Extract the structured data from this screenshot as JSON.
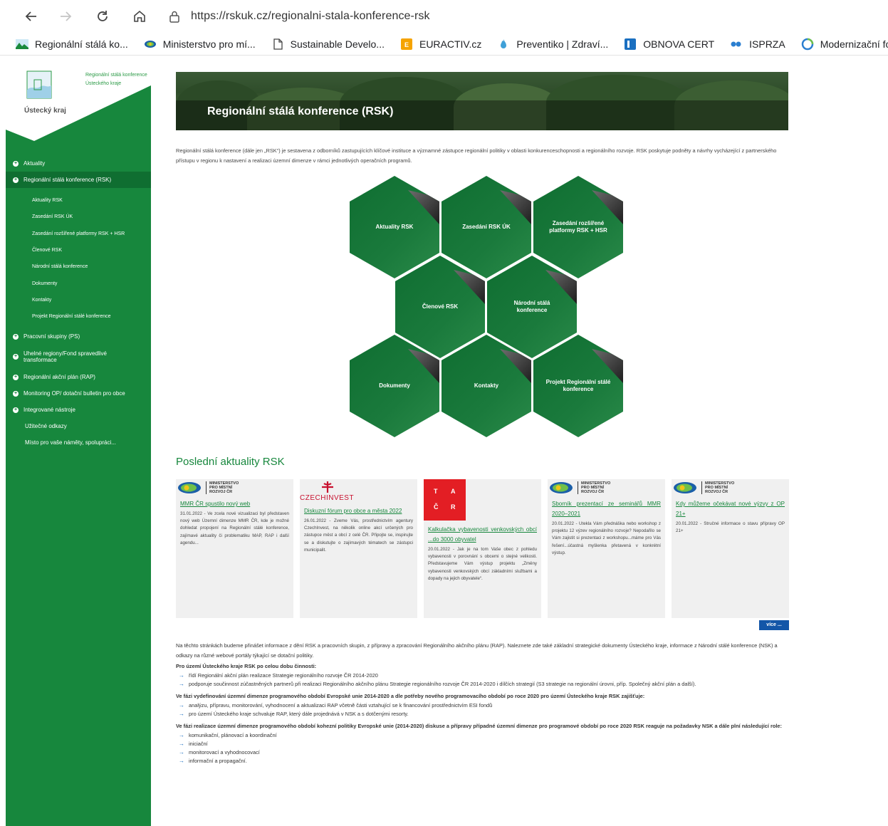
{
  "browser": {
    "url": "https://rskuk.cz/regionalni-stala-konference-rsk",
    "bookmarks": [
      {
        "label": "Regionální stálá ko...",
        "icon": "mountain-icon"
      },
      {
        "label": "Ministerstvo pro mí...",
        "icon": "mmr-icon"
      },
      {
        "label": "Sustainable Develo...",
        "icon": "page-icon"
      },
      {
        "label": "EURACTIV.cz",
        "icon": "euractiv-icon"
      },
      {
        "label": "Preventiko | Zdraví...",
        "icon": "flame-icon"
      },
      {
        "label": "OBNOVA CERT",
        "icon": "cert-icon"
      },
      {
        "label": "ISPRZA",
        "icon": "dots-icon"
      },
      {
        "label": "Modernizační fond...",
        "icon": "circle-icon"
      }
    ]
  },
  "sidebar": {
    "logo_caption_line1": "Regionální stálá konference",
    "logo_caption_line2": "Ústeckého kraje",
    "logo_name": "Ústecký kraj",
    "menu": [
      {
        "label": "Aktuality",
        "bullet": true
      },
      {
        "label": "Regionální stálá konference (RSK)",
        "bullet": true,
        "active": true
      }
    ],
    "submenu": [
      "Aktuality RSK",
      "Zasedání RSK ÚK",
      "Zasedání rozšířené platformy RSK + HSR",
      "Členové RSK",
      "Národní stálá konference",
      "Dokumenty",
      "Kontakty",
      "Projekt Regionální stálé konference"
    ],
    "menu2": [
      {
        "label": "Pracovní skupiny (PS)",
        "bullet": true
      },
      {
        "label": "Uhelné regiony/Fond spravedlivé transformace",
        "bullet": true,
        "two": true
      },
      {
        "label": "Regionální akční plán (RAP)",
        "bullet": true
      },
      {
        "label": "Monitoring OP/ dotační bulletin pro obce",
        "bullet": true
      },
      {
        "label": "Integrované nástroje",
        "bullet": true
      },
      {
        "label": "Užitečné odkazy",
        "bullet": false
      },
      {
        "label": "Místo pro vaše náměty, spolupráci...",
        "bullet": false
      }
    ]
  },
  "banner": {
    "title": "Regionální stálá konference (RSK)"
  },
  "intro": "Regionální stálá konference (dále jen „RSK“) je sestavena z odborníků zastupujících klíčové instituce a významné zástupce regionální politiky v oblasti konkurenceschopnosti a regionálního rozvoje. RSK poskytuje podněty a návrhy vycházející z partnerského přístupu v regionu k nastavení a realizaci územní dimenze v rámci jednotlivých operačních programů.",
  "hexes": [
    "Aktuality RSK",
    "Zasedání RSK ÚK",
    "Zasedání rozšířené platformy RSK + HSR",
    "Členové RSK",
    "Národní stálá konference",
    "Dokumenty",
    "Kontakty",
    "Projekt Regionální stálé konference"
  ],
  "news": {
    "title": "Poslední aktuality RSK",
    "more": "více ...",
    "mmr_logo": [
      "MINISTERSTVO",
      "PRO MÍSTNÍ",
      "ROZVOJ ČR"
    ],
    "czechinvest_logo": "CZECHINVEST",
    "tacr_logo": [
      "T",
      "A",
      "Č",
      "R"
    ],
    "items": [
      {
        "title": "MMR ČR spustilo nový web",
        "text": "31.01.2022 - Ve zcela nové vizualizaci byl představen nový web Územní dimenze MMR ČR, kde je možné dohledat propojení na Regionální stálé konference, zajímavé aktuality či problematiku MAP, RAP i další agendu..."
      },
      {
        "title": "Diskuzní fórum pro obce a města 2022",
        "text": "26.01.2022 - Zveme Vás, prostřednictvím agentury CzechInvest, na několik online akcí určených pro zástupce měst a obcí z celé ČR. Připojte se, inspirujte se a diskutujte o zajímavých tématech se zástupci municipalit."
      },
      {
        "title": "Kalkulačka vybavenosti venkovských obcí ...do 3000 obyvatel",
        "text": "20.01.2022 - Jak je na tom Vaše obec z pohledu vybavenosti v porovnání s obcemi o stejné velikosti. Představujeme Vám výstup projektu „Změny vybavenosti venkovských obcí základními službami a dopady na jejich obyvatele“."
      },
      {
        "title": "Sborník prezentací ze seminářů MMR 2020–2021",
        "text": "20.01.2022 - Utekla Vám přednáška nebo workshop z projektu 12 výzev regionálního rozvoje? Nepodařilo se Vám zajistit si prezentaci z workshopu...máme pro Vás řešení...účastná myšlenka přetavená v konkrétní výstup."
      },
      {
        "title": "Kdy můžeme očekávat nové výzvy z OP 21+",
        "text": "20.01.2022 - Stručné informace o stavu přípravy OP 21+"
      }
    ]
  },
  "content": {
    "p1": "Na těchto stránkách budeme přinášet informace z dění RSK a pracovních skupin, z přípravy a zpracování Regionálního akčního plánu (RAP). Naleznete zde také základní strategické dokumenty Ústeckého kraje, informace z Národní stálé konference (NSK) a odkazy na různé webové portály týkající se dotační politiky.",
    "h1": "Pro území Ústeckého kraje RSK po celou dobu činnosti:",
    "l1": [
      "řídí Regionální akční plán realizace Strategie regionálního rozvoje ČR 2014-2020",
      "podporuje součinnost zúčastněných partnerů při realizaci Regionálního akčního plánu Strategie regionálního rozvoje ČR 2014-2020 i dílčích strategií (S3 strategie na regionální úrovni, příp. Společný akční plán a další)."
    ],
    "h2": "Ve fázi vydefinování územní dimenze programového období Evropské unie 2014-2020 a dle potřeby nového programovacího období po roce 2020 pro území Ústeckého kraje RSK zajišťuje:",
    "l2": [
      "analýzu, přípravu, monitorování, vyhodnocení a aktualizaci RAP včetně části vztahující se k financování prostřednictvím ESI fondů",
      "pro území Ústeckého kraje schvaluje RAP, který dále projednává v NSK a s dotčenými resorty."
    ],
    "h3": "Ve fázi realizace územní dimenze programového období kohezní politiky Evropské unie (2014-2020) diskuse a přípravy případné územní dimenze pro programové období po roce 2020 RSK reaguje na požadavky NSK a dále plní následující role:",
    "l3": [
      "komunikační, plánovací a koordinační",
      "iniciační",
      "monitorovací a vyhodnocovací",
      "informační a propagační."
    ]
  }
}
